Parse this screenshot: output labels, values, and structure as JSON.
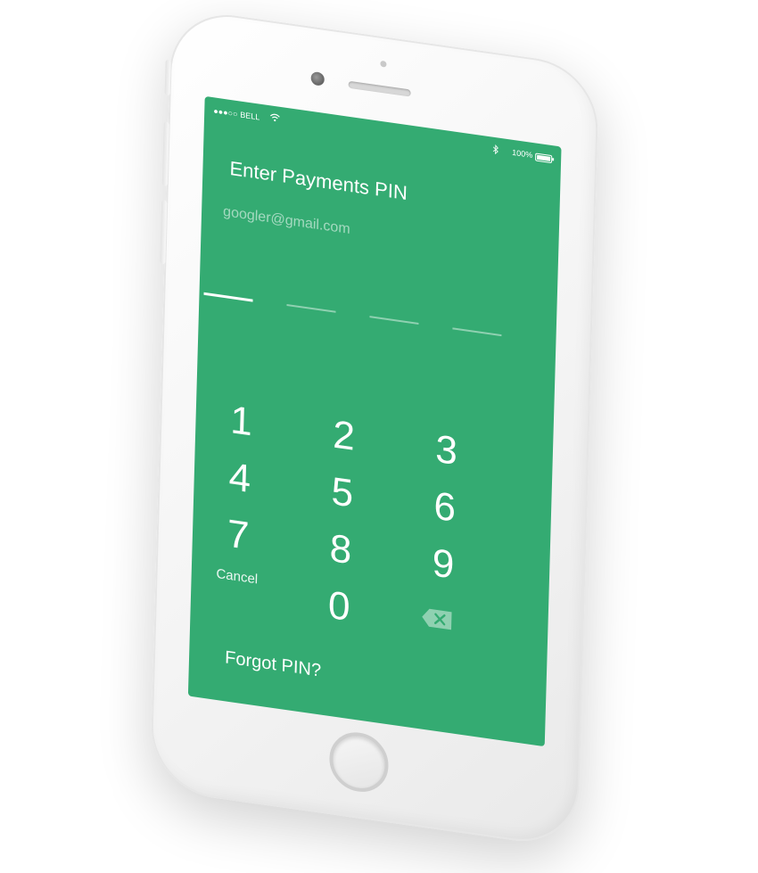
{
  "status_bar": {
    "signal": "●●●○○",
    "carrier": "BELL",
    "wifi_icon": "wifi-icon",
    "bluetooth_icon": "bluetooth-icon",
    "battery_percent": "100%"
  },
  "screen": {
    "title": "Enter Payments PIN",
    "account_email": "googler@gmail.com"
  },
  "pin": {
    "length": 4,
    "filled": 0
  },
  "keypad": {
    "keys": [
      "1",
      "2",
      "3",
      "4",
      "5",
      "6",
      "7",
      "8",
      "9",
      "0"
    ],
    "cancel_label": "Cancel",
    "backspace_icon": "backspace-icon"
  },
  "footer": {
    "forgot_label": "Forgot PIN?"
  },
  "colors": {
    "screen_background": "#34ab72",
    "text": "#ffffff"
  }
}
